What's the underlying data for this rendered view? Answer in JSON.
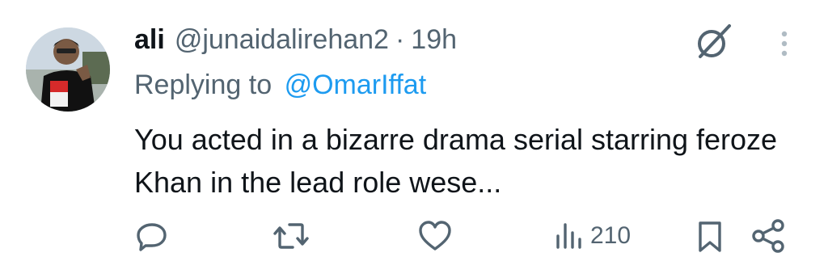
{
  "tweet": {
    "display_name": "ali",
    "handle": "@junaidalirehan2",
    "separator": "·",
    "time": "19h",
    "replying_label": "Replying to",
    "replying_to": "@OmarIffat",
    "text": "You acted in a bizarre drama serial starring feroze Khan in the lead role wese..."
  },
  "actions": {
    "views": "210"
  },
  "icons": {
    "grok": "grok-icon",
    "more": "more-vertical-icon",
    "reply": "reply-icon",
    "retweet": "retweet-icon",
    "like": "heart-icon",
    "views": "views-bar-chart-icon",
    "bookmark": "bookmark-icon",
    "share": "share-icon"
  },
  "colors": {
    "text_primary": "#0f1419",
    "text_secondary": "#536471",
    "link": "#1d9bf0"
  }
}
